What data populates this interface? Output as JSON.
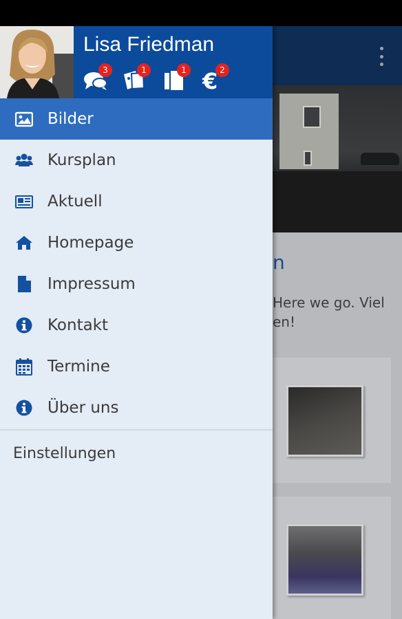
{
  "user": {
    "name": "Lisa Friedman"
  },
  "header_icons": [
    {
      "icon": "chat-bubbles-icon",
      "badge": "3"
    },
    {
      "icon": "tickets-icon",
      "badge": "1"
    },
    {
      "icon": "documents-icon",
      "badge": "1"
    },
    {
      "icon": "euro-icon",
      "badge": "2"
    }
  ],
  "menu": [
    {
      "label": "Bilder",
      "icon": "image-icon",
      "active": true
    },
    {
      "label": "Kursplan",
      "icon": "group-icon"
    },
    {
      "label": "Aktuell",
      "icon": "newspaper-icon"
    },
    {
      "label": "Homepage",
      "icon": "home-icon"
    },
    {
      "label": "Impressum",
      "icon": "document-icon"
    },
    {
      "label": "Kontakt",
      "icon": "info-icon"
    },
    {
      "label": "Termine",
      "icon": "calendar-icon"
    },
    {
      "label": "Über uns",
      "icon": "info-icon"
    }
  ],
  "settings_label": "Einstellungen",
  "background": {
    "heading_fragment": "n",
    "text_line1": "Here we go. Viel",
    "text_line2": "en!"
  },
  "colors": {
    "header_blue": "#0c4a9c",
    "active_item": "#2e6cbf",
    "icon_blue": "#1451a0",
    "drawer_bg": "#e4ecf6",
    "badge_red": "#e5231e"
  }
}
